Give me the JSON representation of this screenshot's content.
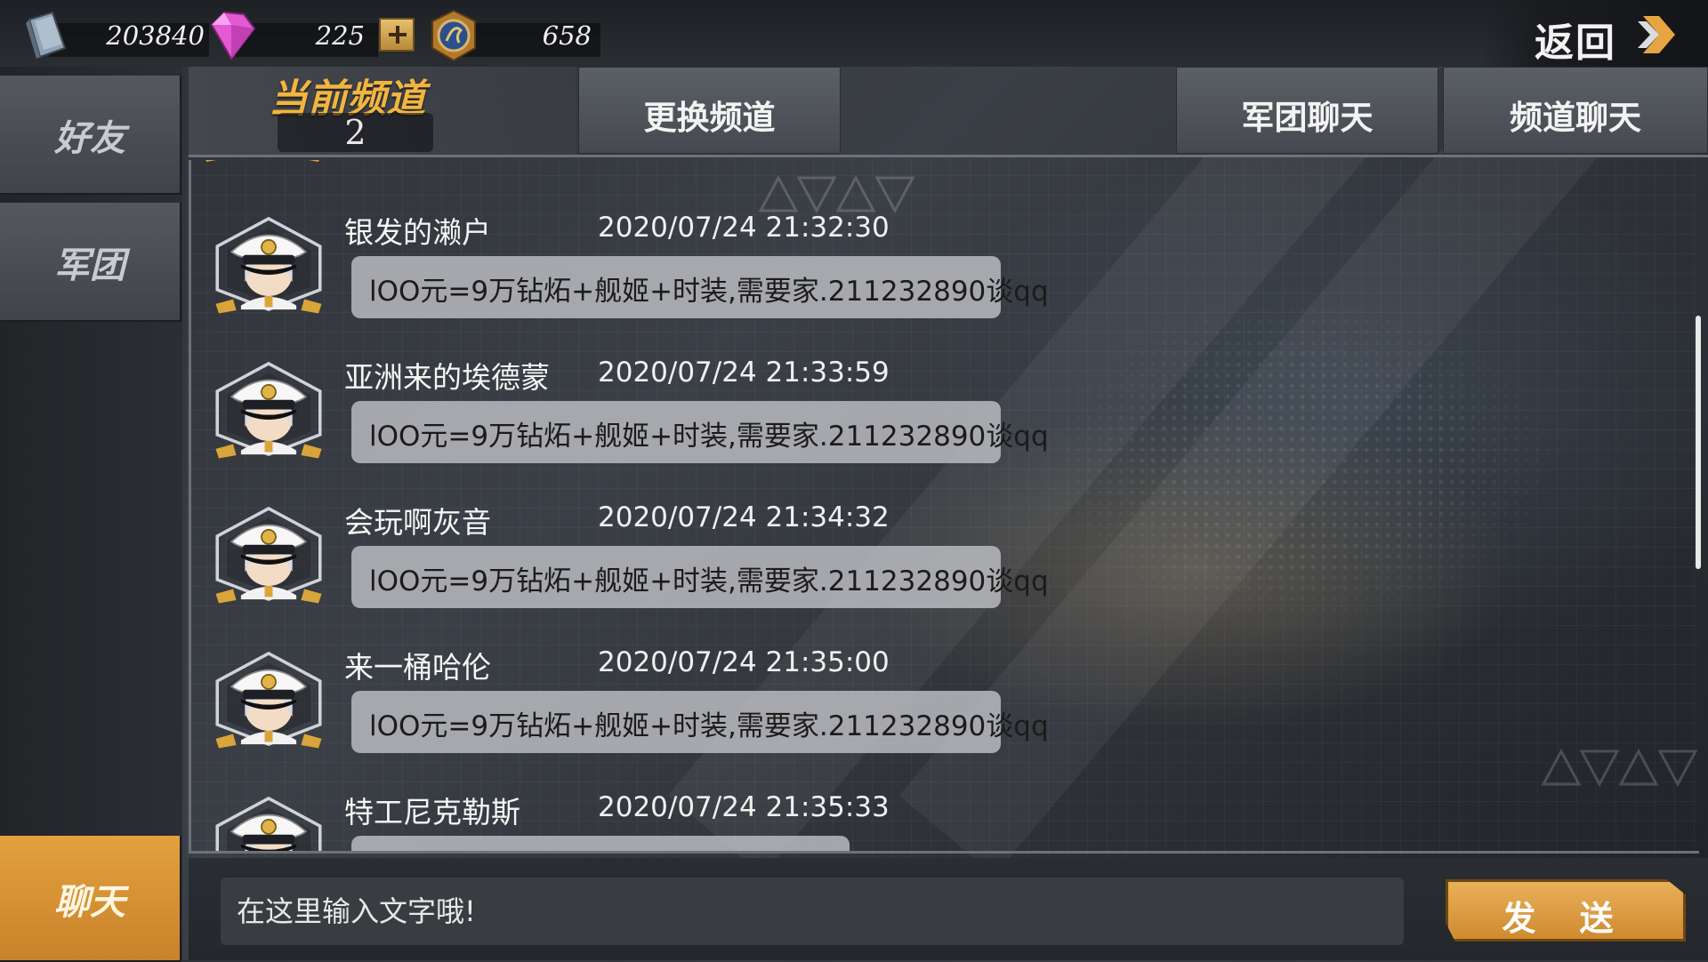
{
  "resources": [
    {
      "icon": "book-icon",
      "value": "203840"
    },
    {
      "icon": "diamond-icon",
      "value": "225"
    },
    {
      "icon": "medal-icon",
      "value": "658"
    }
  ],
  "back_label": "返回",
  "sidenav": {
    "items": [
      {
        "label": "好友",
        "active": false
      },
      {
        "label": "军团",
        "active": false
      },
      {
        "label": "聊天",
        "active": true
      }
    ]
  },
  "header": {
    "current_channel_title": "当前频道",
    "current_channel_number": "2",
    "tabs": [
      {
        "label": "更换频道"
      },
      {
        "label": "军团聊天"
      },
      {
        "label": "频道聊天"
      }
    ]
  },
  "messages": [
    {
      "name": "银发的濑户",
      "time": "2020/07/24 21:32:30",
      "text": "lOO元=9万钻炻+舰姬+时装,需要家.211232890谈qq"
    },
    {
      "name": "亚洲来的埃德蒙",
      "time": "2020/07/24 21:33:59",
      "text": "lOO元=9万钻炻+舰姬+时装,需要家.211232890谈qq"
    },
    {
      "name": "会玩啊灰音",
      "time": "2020/07/24 21:34:32",
      "text": "lOO元=9万钻炻+舰姬+时装,需要家.211232890谈qq"
    },
    {
      "name": "来一桶哈伦",
      "time": "2020/07/24 21:35:00",
      "text": "lOO元=9万钻炻+舰姬+时装,需要家.211232890谈qq"
    },
    {
      "name": "特工尼克勒斯",
      "time": "2020/07/24 21:35:33",
      "text": ""
    }
  ],
  "input": {
    "placeholder": "在这里输入文字哦!",
    "value": ""
  },
  "send_label": "发 送",
  "colors": {
    "accent": "#f1b540",
    "active_nav": "#d8952f",
    "send": "#e0a24a"
  }
}
